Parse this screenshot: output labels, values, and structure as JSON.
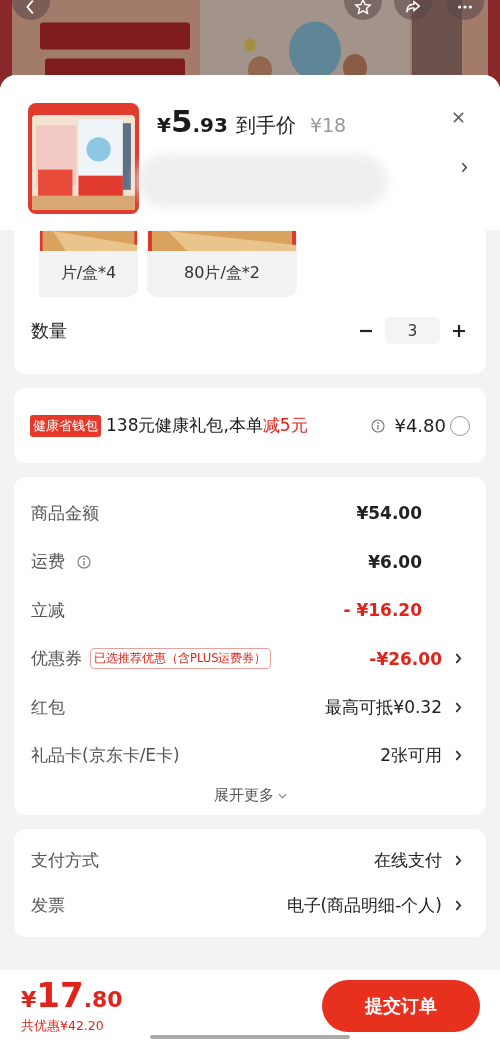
{
  "header": {
    "currency": "¥",
    "price_int": "5",
    "price_dec": ".93",
    "price_label": "到手价",
    "original_price": "¥18"
  },
  "specs": [
    {
      "label": "片/盒*4",
      "selected": false
    },
    {
      "label": "80片/盒*2",
      "selected": false
    }
  ],
  "quantity": {
    "label": "数量",
    "value": "3"
  },
  "wallet": {
    "badge": "健康省钱包",
    "text": "138元健康礼包,本单",
    "highlight": "减5元",
    "price": "¥4.80",
    "checked": false
  },
  "summary": [
    {
      "label": "商品金额",
      "info": false,
      "value": "¥54.00",
      "kind": "amount",
      "chevron": false
    },
    {
      "label": "运费",
      "info": true,
      "value": "¥6.00",
      "kind": "amount",
      "chevron": false
    },
    {
      "label": "立减",
      "info": false,
      "value": "- ¥16.20",
      "kind": "discount",
      "chevron": false
    },
    {
      "label": "优惠券",
      "info": false,
      "tag": "已选推荐优惠（含PLUS运费券）",
      "value": "-¥26.00",
      "kind": "discount",
      "chevron": true
    },
    {
      "label": "红包",
      "info": false,
      "value": "最高可抵¥0.32",
      "kind": "option",
      "chevron": true
    },
    {
      "label": "礼品卡(京东卡/E卡)",
      "info": false,
      "value": "2张可用",
      "kind": "option",
      "chevron": true
    }
  ],
  "expand_more": "展开更多",
  "options": [
    {
      "label": "支付方式",
      "value": "在线支付"
    },
    {
      "label": "发票",
      "value": "电子(商品明细-个人)"
    }
  ],
  "footer": {
    "currency": "¥",
    "total_int": "17",
    "total_dec": ".80",
    "savings": "共优惠¥42.20",
    "submit": "提交订单"
  }
}
